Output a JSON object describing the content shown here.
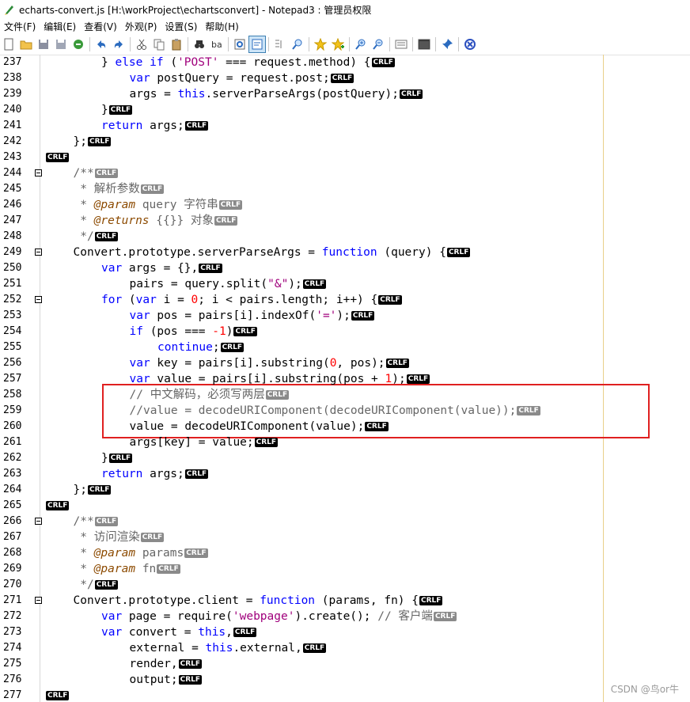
{
  "window": {
    "title": "echarts-convert.js [H:\\workProject\\echartsconvert] - Notepad3 : 管理员权限"
  },
  "menu": [
    "文件(F)",
    "编辑(E)",
    "查看(V)",
    "外观(P)",
    "设置(S)",
    "帮助(H)"
  ],
  "toolbar": [
    {
      "name": "new-icon"
    },
    {
      "name": "open-icon"
    },
    {
      "name": "save-icon"
    },
    {
      "name": "save-as-icon"
    },
    {
      "name": "revert-icon"
    },
    {
      "sep": true
    },
    {
      "name": "undo-icon"
    },
    {
      "name": "redo-icon"
    },
    {
      "sep": true
    },
    {
      "name": "cut-icon"
    },
    {
      "name": "copy-icon"
    },
    {
      "name": "paste-icon"
    },
    {
      "sep": true
    },
    {
      "name": "find-icon"
    },
    {
      "name": "replace-icon"
    },
    {
      "sep": true
    },
    {
      "name": "goto-icon"
    },
    {
      "name": "word-wrap-icon",
      "active": true
    },
    {
      "sep": true
    },
    {
      "name": "view-icon"
    },
    {
      "name": "zoom-search-icon"
    },
    {
      "sep": true
    },
    {
      "name": "favorites-icon"
    },
    {
      "name": "add-favorite-icon"
    },
    {
      "sep": true
    },
    {
      "name": "zoom-in-icon"
    },
    {
      "name": "zoom-out-icon"
    },
    {
      "sep": true
    },
    {
      "name": "schemes-icon"
    },
    {
      "sep": true
    },
    {
      "name": "console-icon"
    },
    {
      "sep": true
    },
    {
      "name": "pin-icon"
    },
    {
      "sep": true
    },
    {
      "name": "exit-icon"
    }
  ],
  "eol_marker": "CRLF",
  "lines": [
    {
      "n": "237",
      "fold": false,
      "i": 2,
      "t": [
        [
          "p",
          "} "
        ],
        [
          "k",
          "else"
        ],
        [
          "p",
          " "
        ],
        [
          "k",
          "if"
        ],
        [
          "p",
          " ("
        ],
        [
          "s",
          "'POST'"
        ],
        [
          "p",
          " === request.method) {"
        ]
      ]
    },
    {
      "n": "238",
      "fold": false,
      "i": 3,
      "t": [
        [
          "k",
          "var"
        ],
        [
          "p",
          " postQuery = request.post;"
        ]
      ]
    },
    {
      "n": "239",
      "fold": false,
      "i": 3,
      "t": [
        [
          "p",
          "args = "
        ],
        [
          "k",
          "this"
        ],
        [
          "p",
          ".serverParseArgs(postQuery);"
        ]
      ]
    },
    {
      "n": "240",
      "fold": false,
      "i": 2,
      "t": [
        [
          "p",
          "}"
        ]
      ]
    },
    {
      "n": "241",
      "fold": false,
      "i": 2,
      "t": [
        [
          "k",
          "return"
        ],
        [
          "p",
          " args;"
        ]
      ]
    },
    {
      "n": "242",
      "fold": false,
      "i": 1,
      "t": [
        [
          "p",
          "};"
        ]
      ]
    },
    {
      "n": "243",
      "fold": false,
      "i": 0,
      "t": []
    },
    {
      "n": "244",
      "fold": true,
      "i": 1,
      "t": [
        [
          "c",
          "/**"
        ]
      ],
      "g": true
    },
    {
      "n": "245",
      "fold": false,
      "i": 1,
      "t": [
        [
          "c",
          " * 解析参数"
        ]
      ],
      "g": true
    },
    {
      "n": "246",
      "fold": false,
      "i": 1,
      "t": [
        [
          "c",
          " * "
        ],
        [
          "tg",
          "@param"
        ],
        [
          "c",
          " query 字符串"
        ]
      ],
      "g": true
    },
    {
      "n": "247",
      "fold": false,
      "i": 1,
      "t": [
        [
          "c",
          " * "
        ],
        [
          "tg",
          "@returns"
        ],
        [
          "c",
          " {{}} 对象"
        ]
      ],
      "g": true
    },
    {
      "n": "248",
      "fold": false,
      "i": 1,
      "t": [
        [
          "c",
          " */"
        ]
      ]
    },
    {
      "n": "249",
      "fold": true,
      "i": 1,
      "t": [
        [
          "p",
          "Convert.prototype.serverParseArgs = "
        ],
        [
          "k",
          "function"
        ],
        [
          "p",
          " (query) {"
        ]
      ]
    },
    {
      "n": "250",
      "fold": false,
      "i": 2,
      "t": [
        [
          "k",
          "var"
        ],
        [
          "p",
          " args = {},"
        ]
      ]
    },
    {
      "n": "251",
      "fold": false,
      "i": 3,
      "t": [
        [
          "p",
          "pairs = query.split("
        ],
        [
          "s",
          "\"&\""
        ],
        [
          "p",
          ");"
        ]
      ]
    },
    {
      "n": "252",
      "fold": true,
      "i": 2,
      "t": [
        [
          "k",
          "for"
        ],
        [
          "p",
          " ("
        ],
        [
          "k",
          "var"
        ],
        [
          "p",
          " i = "
        ],
        [
          "n",
          "0"
        ],
        [
          "p",
          "; i < pairs.length; i++) {"
        ]
      ]
    },
    {
      "n": "253",
      "fold": false,
      "i": 3,
      "t": [
        [
          "k",
          "var"
        ],
        [
          "p",
          " pos = pairs[i].indexOf("
        ],
        [
          "s",
          "'='"
        ],
        [
          "p",
          ");"
        ]
      ]
    },
    {
      "n": "254",
      "fold": false,
      "i": 3,
      "t": [
        [
          "k",
          "if"
        ],
        [
          "p",
          " (pos === "
        ],
        [
          "n",
          "-1"
        ],
        [
          "p",
          ")"
        ]
      ]
    },
    {
      "n": "255",
      "fold": false,
      "i": 4,
      "t": [
        [
          "k",
          "continue"
        ],
        [
          "p",
          ";"
        ]
      ]
    },
    {
      "n": "256",
      "fold": false,
      "i": 3,
      "t": [
        [
          "k",
          "var"
        ],
        [
          "p",
          " key = pairs[i].substring("
        ],
        [
          "n",
          "0"
        ],
        [
          "p",
          ", pos);"
        ]
      ]
    },
    {
      "n": "257",
      "fold": false,
      "i": 3,
      "t": [
        [
          "k",
          "var"
        ],
        [
          "p",
          " value = pairs[i].substring(pos + "
        ],
        [
          "n",
          "1"
        ],
        [
          "p",
          ");"
        ]
      ]
    },
    {
      "n": "258",
      "fold": false,
      "i": 3,
      "t": [
        [
          "c",
          "// 中文解码，必须写两层"
        ]
      ],
      "g": true
    },
    {
      "n": "259",
      "fold": false,
      "i": 3,
      "t": [
        [
          "c",
          "//value = decodeURIComponent(decodeURIComponent(value));"
        ]
      ],
      "g": true
    },
    {
      "n": "260",
      "fold": false,
      "i": 3,
      "t": [
        [
          "p",
          "value = decodeURIComponent(value);"
        ]
      ]
    },
    {
      "n": "261",
      "fold": false,
      "i": 3,
      "t": [
        [
          "p",
          "args[key] = value;"
        ]
      ]
    },
    {
      "n": "262",
      "fold": false,
      "i": 2,
      "t": [
        [
          "p",
          "}"
        ]
      ]
    },
    {
      "n": "263",
      "fold": false,
      "i": 2,
      "t": [
        [
          "k",
          "return"
        ],
        [
          "p",
          " args;"
        ]
      ]
    },
    {
      "n": "264",
      "fold": false,
      "i": 1,
      "t": [
        [
          "p",
          "};"
        ]
      ]
    },
    {
      "n": "265",
      "fold": false,
      "i": 0,
      "t": []
    },
    {
      "n": "266",
      "fold": true,
      "i": 1,
      "t": [
        [
          "c",
          "/**"
        ]
      ],
      "g": true
    },
    {
      "n": "267",
      "fold": false,
      "i": 1,
      "t": [
        [
          "c",
          " * 访问渲染"
        ]
      ],
      "g": true
    },
    {
      "n": "268",
      "fold": false,
      "i": 1,
      "t": [
        [
          "c",
          " * "
        ],
        [
          "tg",
          "@param"
        ],
        [
          "c",
          " params"
        ]
      ],
      "g": true
    },
    {
      "n": "269",
      "fold": false,
      "i": 1,
      "t": [
        [
          "c",
          " * "
        ],
        [
          "tg",
          "@param"
        ],
        [
          "c",
          " fn"
        ]
      ],
      "g": true
    },
    {
      "n": "270",
      "fold": false,
      "i": 1,
      "t": [
        [
          "c",
          " */"
        ]
      ]
    },
    {
      "n": "271",
      "fold": true,
      "i": 1,
      "t": [
        [
          "p",
          "Convert.prototype.client = "
        ],
        [
          "k",
          "function"
        ],
        [
          "p",
          " (params, fn) {"
        ]
      ]
    },
    {
      "n": "272",
      "fold": false,
      "i": 2,
      "t": [
        [
          "k",
          "var"
        ],
        [
          "p",
          " page = require("
        ],
        [
          "s",
          "'webpage'"
        ],
        [
          "p",
          ").create(); "
        ],
        [
          "c",
          "// 客户端"
        ]
      ],
      "g": true
    },
    {
      "n": "273",
      "fold": false,
      "i": 2,
      "t": [
        [
          "k",
          "var"
        ],
        [
          "p",
          " convert = "
        ],
        [
          "k",
          "this"
        ],
        [
          "p",
          ","
        ]
      ]
    },
    {
      "n": "274",
      "fold": false,
      "i": 3,
      "t": [
        [
          "p",
          "external = "
        ],
        [
          "k",
          "this"
        ],
        [
          "p",
          ".external,"
        ]
      ]
    },
    {
      "n": "275",
      "fold": false,
      "i": 3,
      "t": [
        [
          "p",
          "render,"
        ]
      ]
    },
    {
      "n": "276",
      "fold": false,
      "i": 3,
      "t": [
        [
          "p",
          "output;"
        ]
      ]
    },
    {
      "n": "277",
      "fold": false,
      "i": 0,
      "t": []
    }
  ],
  "watermark": "CSDN @鸟or牛"
}
